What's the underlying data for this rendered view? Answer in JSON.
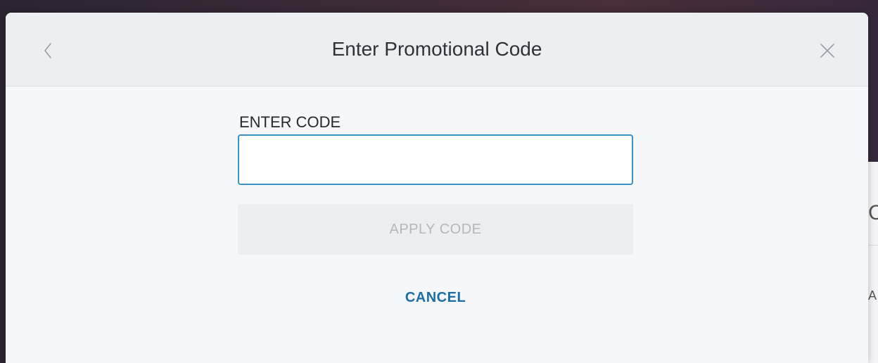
{
  "dialog": {
    "title": "Enter Promotional Code",
    "back_icon": "chevron-left-icon",
    "close_icon": "close-icon"
  },
  "form": {
    "field_label": "ENTER CODE",
    "input_value": "",
    "apply_label": "APPLY CODE",
    "cancel_label": "CANCEL"
  },
  "colors": {
    "accent": "#3a93c7",
    "link": "#1a6fa7",
    "disabled_text": "#b4b7bb"
  }
}
